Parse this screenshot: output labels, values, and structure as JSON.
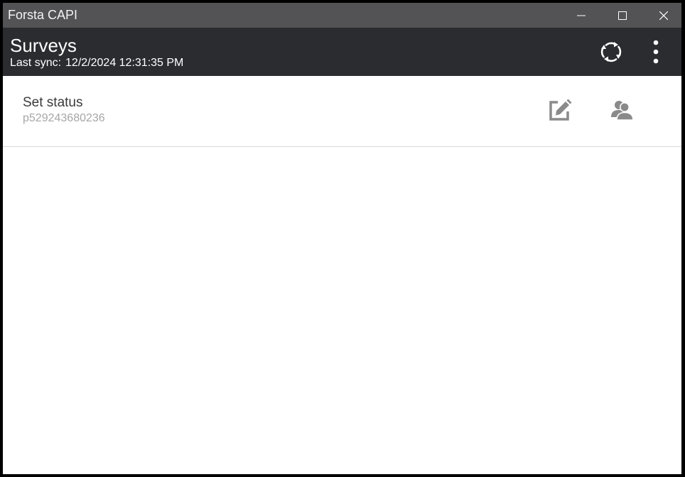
{
  "window": {
    "title": "Forsta CAPI",
    "controls": {
      "minimize": "minimize-icon",
      "maximize": "maximize-icon",
      "close": "close-icon"
    }
  },
  "appbar": {
    "title": "Surveys",
    "sync_label": "Last sync:",
    "sync_value": "12/2/2024 12:31:35 PM",
    "actions": {
      "sync": "sync-icon",
      "more": "more-vertical-icon"
    }
  },
  "surveys": [
    {
      "name": "Set status",
      "id": "p529243680236",
      "actions": {
        "edit": "edit-icon",
        "respondents": "respondents-icon"
      }
    }
  ],
  "colors": {
    "titlebar": "#535355",
    "appbar": "#2a2c30",
    "icon_gray": "#8a8a8a",
    "divider": "#d9d9d9",
    "subtext": "#a6a6a6"
  }
}
